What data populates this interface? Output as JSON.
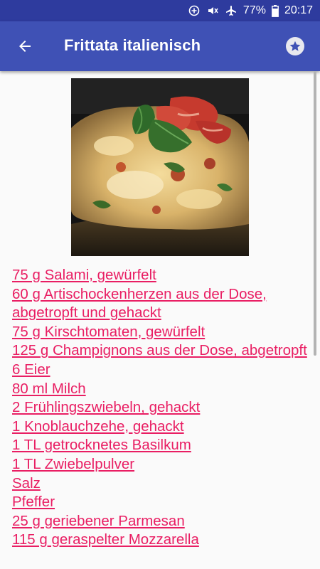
{
  "status_bar": {
    "battery": "77%",
    "time": "20:17",
    "icons": [
      "data-saver-icon",
      "mute-icon",
      "airplane-icon",
      "battery-icon"
    ]
  },
  "app_bar": {
    "title": "Frittata italienisch",
    "back_icon": "arrow-left-icon",
    "favorite_icon": "star-icon"
  },
  "recipe": {
    "image": "frittata-photo",
    "ingredients": [
      "75 g Salami, gewürfelt",
      "60 g Artischockenherzen aus der Dose, abgetropft und gehackt",
      "75 g Kirschtomaten, gewürfelt",
      "125 g Champignons aus der Dose, abgetropft",
      "6 Eier",
      "80 ml Milch",
      "2 Frühlingszwiebeln, gehackt",
      "1 Knoblauchzehe, gehackt",
      "1 TL getrocknetes Basilkum",
      "1 TL Zwiebelpulver",
      "Salz",
      "Pfeffer",
      "25 g geriebener Parmesan",
      "115 g geraspelter Mozzarella"
    ]
  },
  "colors": {
    "status_bar": "#2e3b9e",
    "app_bar": "#3f51b5",
    "link": "#e91e63",
    "background": "#fafafa"
  }
}
